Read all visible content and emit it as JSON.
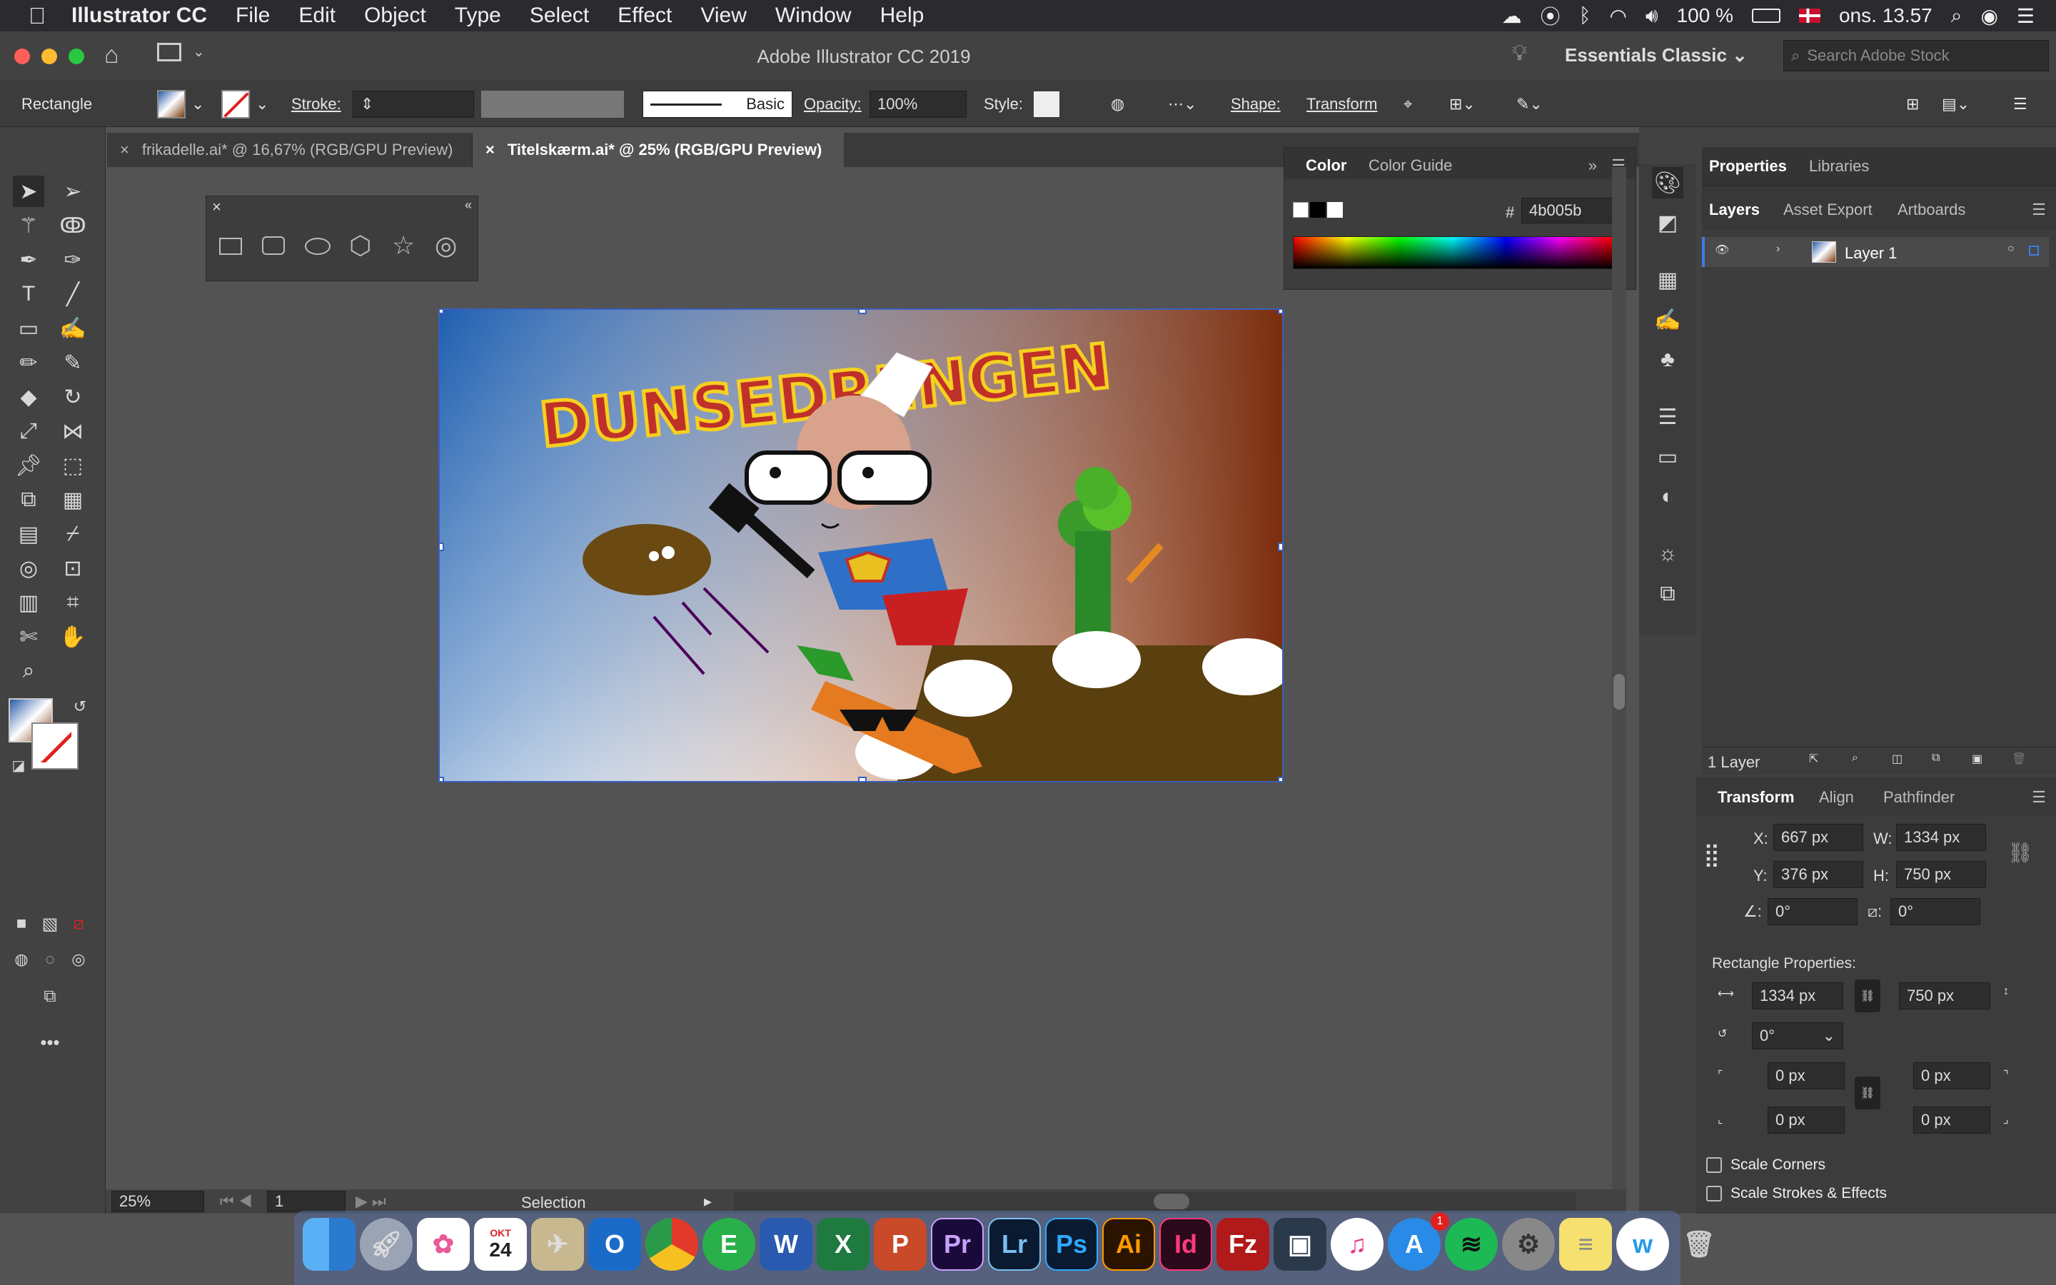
{
  "menubar": {
    "items": [
      "Illustrator CC",
      "File",
      "Edit",
      "Object",
      "Type",
      "Select",
      "Effect",
      "View",
      "Window",
      "Help"
    ],
    "battery": "100 %",
    "clock": "ons. 13.57"
  },
  "window": {
    "title": "Adobe Illustrator CC 2019",
    "workspace": "Essentials Classic",
    "search_placeholder": "Search Adobe Stock"
  },
  "control": {
    "object_type": "Rectangle",
    "stroke_label": "Stroke:",
    "brush": "Basic",
    "opacity_label": "Opacity:",
    "opacity_value": "100%",
    "style_label": "Style:",
    "shape_label": "Shape:",
    "transform_label": "Transform"
  },
  "tabs": [
    {
      "label": "frikadelle.ai* @ 16,67% (RGB/GPU Preview)",
      "active": false
    },
    {
      "label": "Titelskærm.ai* @ 25% (RGB/GPU Preview)",
      "active": true
    }
  ],
  "color_panel": {
    "tab_color": "Color",
    "tab_guide": "Color Guide",
    "hex_symbol": "#",
    "hex_value": "4b005b"
  },
  "artwork": {
    "title_text": "DUNSEDRENGEN"
  },
  "status": {
    "zoom": "25%",
    "artboard": "1",
    "tool": "Selection"
  },
  "right_panel": {
    "top_tabs": [
      "Properties",
      "Libraries"
    ],
    "layer_tabs": [
      "Layers",
      "Asset Export",
      "Artboards"
    ],
    "layer_name": "Layer 1",
    "layer_count": "1 Layer",
    "transform_tabs": [
      "Transform",
      "Align",
      "Pathfinder"
    ],
    "x_label": "X:",
    "x_value": "667 px",
    "y_label": "Y:",
    "y_value": "376 px",
    "w_label": "W:",
    "w_value": "1334 px",
    "h_label": "H:",
    "h_value": "750 px",
    "angle1": "0°",
    "angle2": "0°",
    "rect_props_label": "Rectangle Properties:",
    "rect_w": "1334 px",
    "rect_h": "750 px",
    "rect_angle": "0°",
    "corner_tl": "0 px",
    "corner_tr": "0 px",
    "corner_bl": "0 px",
    "corner_br": "0 px",
    "scale_corners": "Scale Corners",
    "scale_strokes": "Scale Strokes & Effects"
  },
  "dock": {
    "calendar_month": "OKT",
    "calendar_day": "24",
    "badge_appstore": "1",
    "apps": [
      "Pr",
      "Lr",
      "Ps",
      "Ai",
      "Id"
    ]
  },
  "colors": {
    "accent": "#3a5fc0",
    "ai_orange": "#ff9a00",
    "title_red": "#c0302a"
  }
}
